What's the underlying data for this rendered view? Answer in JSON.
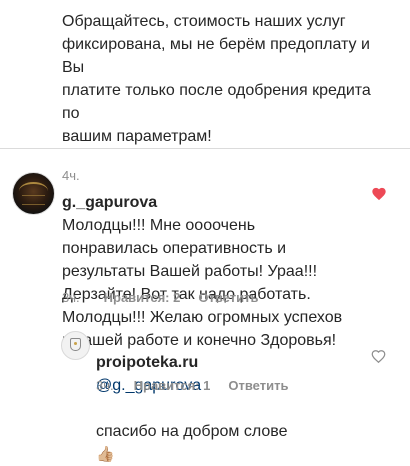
{
  "top_comment": {
    "text": "Обращайтесь, стоимость наших услуг\nфиксирована, мы не берём предоплату и Вы\nплатите только после одобрения кредита по\nвашим параметрам!",
    "time": "4ч."
  },
  "main_comment": {
    "username": "g._gapurova",
    "text": "Молодцы!!! Мне оооочень\nпонравилась оперативность и\nрезультаты Вашей работы! Ураа!!!\nДерзайте! Вот так надо работать.\nМолодцы!!! Желаю огромных успехов\nв вашей работе и конечно Здоровья!",
    "time": "3ч.",
    "likes": "Нравится: 2",
    "reply_label": "Ответить",
    "liked": true,
    "heart_color": "#ed4956"
  },
  "reply": {
    "username": "proipoteka.ru",
    "mention": "@g._gapurova",
    "text": "спасибо на добром слове",
    "emoji": "👍🏼",
    "time": "3ч.",
    "likes": "Нравится: 1",
    "reply_label": "Ответить",
    "liked": false
  },
  "icons": {
    "main_like": "heart-filled-icon",
    "reply_like": "heart-outline-icon"
  }
}
